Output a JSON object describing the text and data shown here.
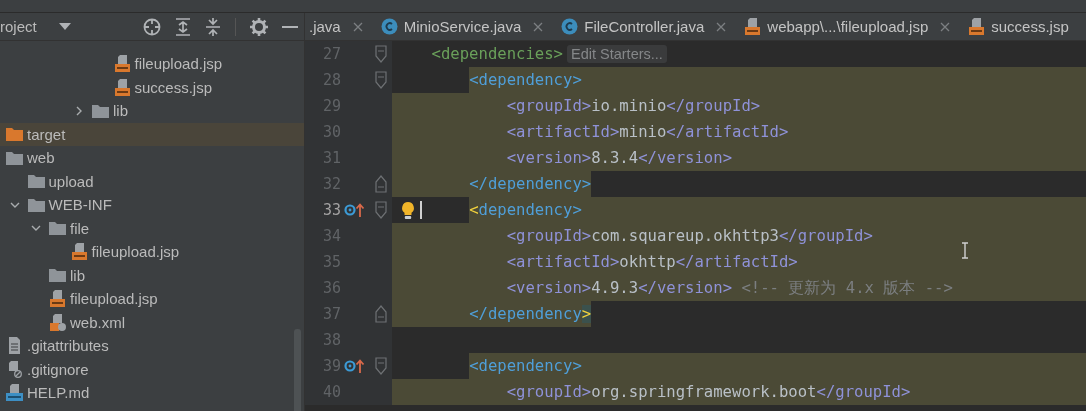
{
  "project_panel": {
    "title": "roject",
    "tree": [
      {
        "children": [
          {
            "children": [
              {
                "children": [
                  {
                    "children": [
                      {
                        "children": [
                          {
                            "label": "fileupload.jsp",
                            "kind": "jsp",
                            "selected": false
                          },
                          {
                            "label": "success.jsp",
                            "kind": "jsp",
                            "selected": false
                          }
                        ]
                      },
                      {
                        "label": "lib",
                        "kind": "folder",
                        "expanded": false,
                        "selected": false
                      }
                    ]
                  }
                ]
              }
            ]
          }
        ]
      },
      {
        "label": "target",
        "kind": "excluded",
        "selected": true
      },
      {
        "label": "web",
        "kind": "folder",
        "selected": false,
        "children": [
          {
            "label": "upload",
            "kind": "folder",
            "selected": false
          },
          {
            "label": "WEB-INF",
            "kind": "folder",
            "expanded": true,
            "selected": false,
            "children": [
              {
                "label": "file",
                "kind": "folder",
                "expanded": true,
                "selected": false,
                "children": [
                  {
                    "label": "fileupload.jsp",
                    "kind": "jsp",
                    "selected": false
                  }
                ]
              },
              {
                "label": "lib",
                "kind": "folder",
                "selected": false
              },
              {
                "label": "fileupload.jsp",
                "kind": "jsp",
                "selected": false
              },
              {
                "label": "web.xml",
                "kind": "xml",
                "selected": false
              }
            ]
          }
        ]
      },
      {
        "label": ".gitattributes",
        "kind": "text",
        "selected": false
      },
      {
        "label": ".gitignore",
        "kind": "ignored",
        "selected": false
      },
      {
        "label": "HELP.md",
        "kind": "markdown",
        "selected": false
      }
    ]
  },
  "tabs": [
    {
      "label": ".java",
      "kind": "plain",
      "selected": false,
      "closable": true
    },
    {
      "label": "MinioService.java",
      "kind": "class",
      "selected": false,
      "closable": true
    },
    {
      "label": "FileController.java",
      "kind": "class",
      "selected": false,
      "closable": true
    },
    {
      "label": "webapp\\...\\fileupload.jsp",
      "kind": "jsp",
      "selected": false,
      "closable": true
    },
    {
      "label": "success.jsp",
      "kind": "jsp",
      "selected": false,
      "closable": false
    }
  ],
  "editor": {
    "lines": [
      {
        "number": "27",
        "current": false,
        "highlight_indent": false,
        "highlight_tail": false,
        "markers": [
          {
            "kind": "fold-start"
          }
        ],
        "tokens": [
          {
            "kind": "tag-outer",
            "text": "<dependencies>"
          }
        ],
        "hint": "Edit Starters...",
        "children": [
          {
            "number": "28",
            "current": false,
            "highlight_indent": false,
            "highlight_tail": true,
            "markers": [
              {
                "kind": "fold-start"
              }
            ],
            "tokens": [
              {
                "kind": "tag",
                "text": "<dependency>"
              }
            ],
            "children": [
              {
                "number": "29",
                "current": false,
                "highlight_indent": true,
                "highlight_tail": true,
                "tokens": [
                  {
                    "kind": "tag-inner",
                    "text": "<groupId>"
                  },
                  {
                    "kind": "text",
                    "text": "io.minio"
                  },
                  {
                    "kind": "tag-inner",
                    "text": "</groupId>"
                  }
                ]
              },
              {
                "number": "30",
                "current": false,
                "highlight_indent": true,
                "highlight_tail": true,
                "tokens": [
                  {
                    "kind": "tag-inner",
                    "text": "<artifactId>"
                  },
                  {
                    "kind": "text",
                    "text": "minio"
                  },
                  {
                    "kind": "tag-inner",
                    "text": "</artifactId>"
                  }
                ]
              },
              {
                "number": "31",
                "current": false,
                "highlight_indent": true,
                "highlight_tail": true,
                "tokens": [
                  {
                    "kind": "tag-inner",
                    "text": "<version>"
                  },
                  {
                    "kind": "text",
                    "text": "8.3.4"
                  },
                  {
                    "kind": "tag-inner",
                    "text": "</version>"
                  }
                ]
              }
            ]
          },
          {
            "number": "32",
            "current": false,
            "highlight_indent": true,
            "highlight_tail": false,
            "markers": [
              {
                "kind": "fold-end"
              }
            ],
            "tokens": [
              {
                "kind": "tag",
                "text": "</dependency>"
              }
            ]
          },
          {
            "number": "33",
            "current": true,
            "highlight_indent": false,
            "highlight_tail": true,
            "markers": [
              {
                "kind": "implements"
              },
              {
                "kind": "fold-start"
              },
              {
                "kind": "bulb"
              },
              {
                "kind": "caret"
              }
            ],
            "tokens": [
              {
                "kind": "brace",
                "text": "<"
              },
              {
                "kind": "tag",
                "text": "dependency>"
              }
            ],
            "children": [
              {
                "number": "34",
                "current": false,
                "highlight_indent": true,
                "highlight_tail": true,
                "tokens": [
                  {
                    "kind": "tag-inner",
                    "text": "<groupId>"
                  },
                  {
                    "kind": "text",
                    "text": "com.squareup.okhttp3"
                  },
                  {
                    "kind": "tag-inner",
                    "text": "</groupId>"
                  }
                ]
              },
              {
                "number": "35",
                "current": false,
                "highlight_indent": true,
                "highlight_tail": true,
                "tokens": [
                  {
                    "kind": "tag-inner",
                    "text": "<artifactId>"
                  },
                  {
                    "kind": "text",
                    "text": "okhttp"
                  },
                  {
                    "kind": "tag-inner",
                    "text": "</artifactId>"
                  }
                ]
              },
              {
                "number": "36",
                "current": false,
                "highlight_indent": true,
                "highlight_tail": true,
                "tokens": [
                  {
                    "kind": "tag-inner",
                    "text": "<version>"
                  },
                  {
                    "kind": "text",
                    "text": "4.9.3"
                  },
                  {
                    "kind": "tag-inner",
                    "text": "</version>"
                  },
                  {
                    "kind": "comment",
                    "text": " <!-- 更新为 4.x 版本 -->"
                  }
                ]
              }
            ]
          },
          {
            "number": "37",
            "current": false,
            "highlight_indent": true,
            "highlight_tail": false,
            "markers": [
              {
                "kind": "fold-end"
              }
            ],
            "tokens": [
              {
                "kind": "tag",
                "text": "</dependency"
              },
              {
                "kind": "brace-match",
                "text": ">"
              }
            ]
          },
          {
            "number": "38",
            "current": false,
            "highlight_indent": false,
            "highlight_tail": false
          },
          {
            "number": "39",
            "current": false,
            "highlight_indent": false,
            "highlight_tail": true,
            "markers": [
              {
                "kind": "implements"
              },
              {
                "kind": "fold-start"
              }
            ],
            "tokens": [
              {
                "kind": "tag",
                "text": "<dependency>"
              }
            ],
            "children": [
              {
                "number": "40",
                "current": false,
                "highlight_indent": true,
                "highlight_tail": true,
                "tokens": [
                  {
                    "kind": "tag-inner",
                    "text": "<groupId>"
                  },
                  {
                    "kind": "text",
                    "text": "org.springframework.boot"
                  },
                  {
                    "kind": "tag-inner",
                    "text": "</groupId>"
                  }
                ]
              }
            ]
          }
        ]
      }
    ]
  }
}
